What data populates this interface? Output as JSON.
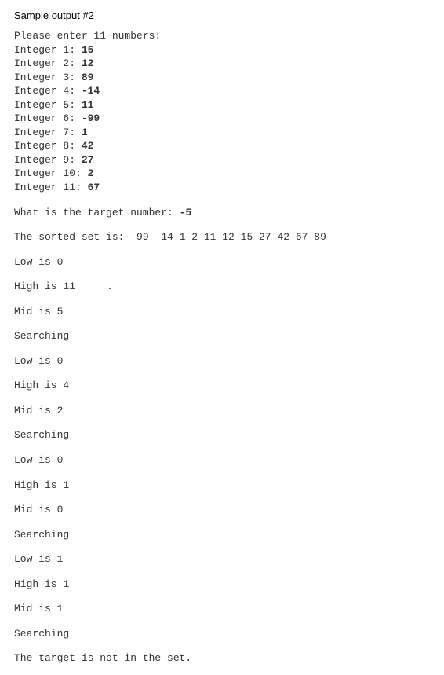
{
  "heading": "Sample output #2",
  "prompt_enter": "Please enter 11 numbers:",
  "integer_label": "Integer ",
  "colon": ": ",
  "inputs": [
    {
      "n": "1",
      "v": "15"
    },
    {
      "n": "2",
      "v": "12"
    },
    {
      "n": "3",
      "v": "89"
    },
    {
      "n": "4",
      "v": "-14"
    },
    {
      "n": "5",
      "v": "11"
    },
    {
      "n": "6",
      "v": "-99"
    },
    {
      "n": "7",
      "v": "1"
    },
    {
      "n": "8",
      "v": "42"
    },
    {
      "n": "9",
      "v": "27"
    },
    {
      "n": "10",
      "v": "2"
    },
    {
      "n": "11",
      "v": "67"
    }
  ],
  "target_label": "What is the target number: ",
  "target_value": "-5",
  "sorted_label": "The sorted set is: ",
  "sorted_values": "-99 -14 1 2 11 12 15 27 42 67 89",
  "trace": [
    {
      "text": "Low is 0",
      "dot": false
    },
    {
      "text": "High is 11",
      "dot": true
    },
    {
      "text": "Mid is 5",
      "dot": false
    },
    {
      "text": "Searching",
      "dot": false
    },
    {
      "text": "Low is 0",
      "dot": false
    },
    {
      "text": "High is 4",
      "dot": false
    },
    {
      "text": "Mid is 2",
      "dot": false
    },
    {
      "text": "Searching",
      "dot": false
    },
    {
      "text": "Low is 0",
      "dot": false
    },
    {
      "text": "High is 1",
      "dot": false
    },
    {
      "text": "Mid is 0",
      "dot": false
    },
    {
      "text": "Searching",
      "dot": false
    },
    {
      "text": "Low is 1",
      "dot": false
    },
    {
      "text": "High is 1",
      "dot": false
    },
    {
      "text": "Mid is 1",
      "dot": false
    },
    {
      "text": "Searching",
      "dot": false
    },
    {
      "text": "The target is not in the set.",
      "dot": false
    }
  ],
  "dot_char": "."
}
